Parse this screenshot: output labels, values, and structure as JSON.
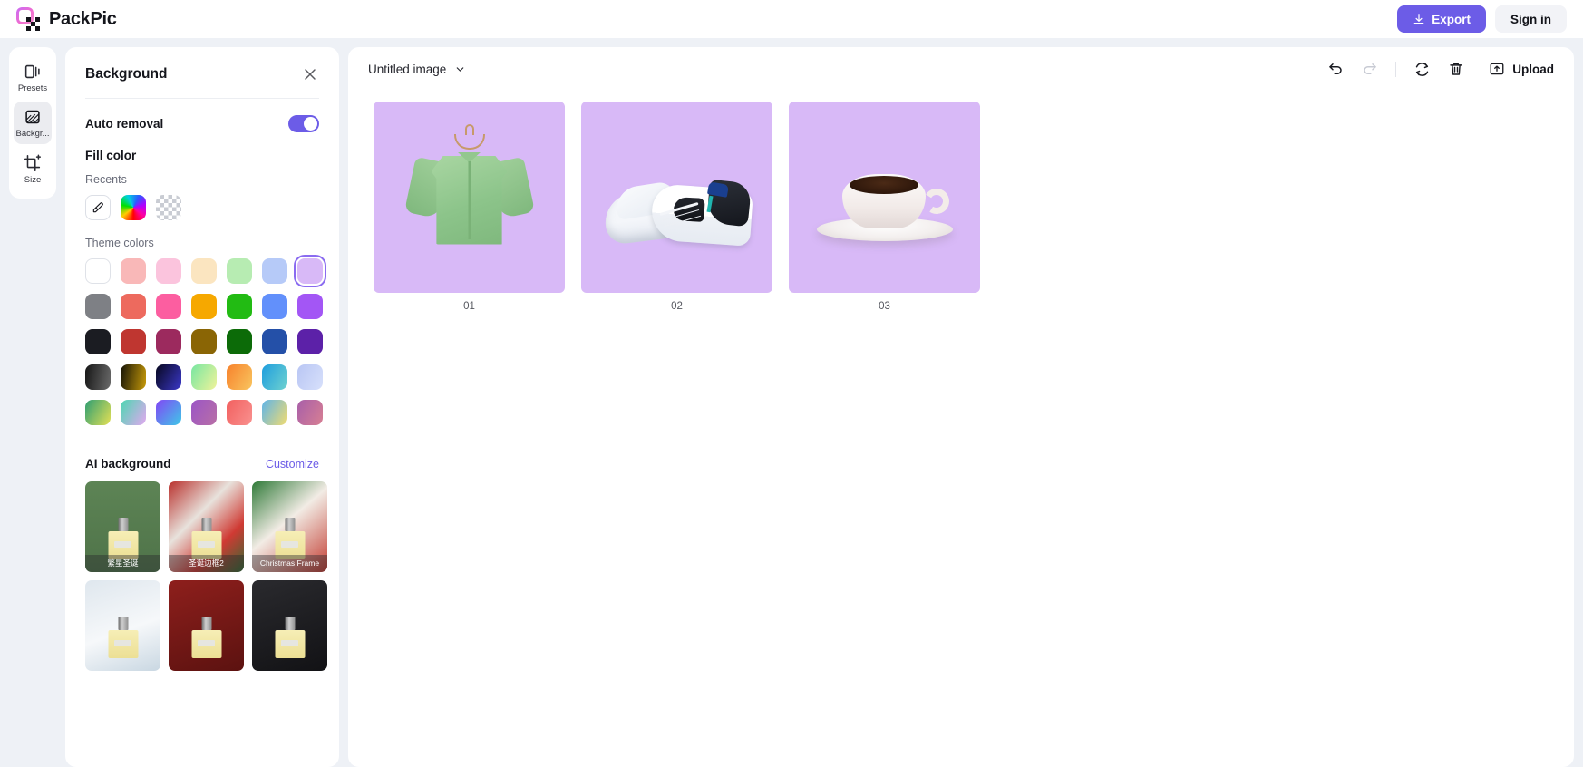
{
  "app": {
    "brand": "PackPic",
    "logo_icon": "packpic-logo-icon"
  },
  "header": {
    "export_label": "Export",
    "export_icon": "download-icon",
    "signin_label": "Sign in",
    "accent_color": "#6c5ce7"
  },
  "rail": {
    "items": [
      {
        "label": "Presets",
        "icon": "presets-icon",
        "active": false
      },
      {
        "label": "Backgr...",
        "icon": "background-icon",
        "active": true
      },
      {
        "label": "Size",
        "icon": "crop-size-icon",
        "active": false
      }
    ]
  },
  "panel": {
    "title": "Background",
    "close_icon": "close-icon",
    "auto_removal": {
      "label": "Auto removal",
      "enabled": true
    },
    "fill_color": {
      "title": "Fill color",
      "recents_label": "Recents",
      "recents": [
        {
          "name": "eyedropper-swatch",
          "kind": "eyedropper"
        },
        {
          "name": "rainbow-swatch",
          "kind": "rainbow"
        },
        {
          "name": "transparent-swatch",
          "kind": "transparent"
        }
      ],
      "theme_colors_label": "Theme colors",
      "theme_colors": [
        {
          "hex": "#ffffff",
          "selected": false
        },
        {
          "hex": "#f9b8b8",
          "selected": false
        },
        {
          "hex": "#fbc4dd",
          "selected": false
        },
        {
          "hex": "#fbe5c0",
          "selected": false
        },
        {
          "hex": "#b7ecb2",
          "selected": false
        },
        {
          "hex": "#b6caf8",
          "selected": false
        },
        {
          "hex": "#d8b9f7",
          "selected": true
        },
        {
          "hex": "#7e8085",
          "selected": false
        },
        {
          "hex": "#ed6a5e",
          "selected": false
        },
        {
          "hex": "#fc5ea0",
          "selected": false
        },
        {
          "hex": "#f6a800",
          "selected": false
        },
        {
          "hex": "#22bb13",
          "selected": false
        },
        {
          "hex": "#6290fb",
          "selected": false
        },
        {
          "hex": "#a356f5",
          "selected": false
        },
        {
          "hex": "#1b1c22",
          "selected": false
        },
        {
          "hex": "#bf3630",
          "selected": false
        },
        {
          "hex": "#9c2a5e",
          "selected": false
        },
        {
          "hex": "#8a6505",
          "selected": false
        },
        {
          "hex": "#0c6b08",
          "selected": false
        },
        {
          "hex": "#2450a8",
          "selected": false
        },
        {
          "hex": "#5c21a8",
          "selected": false
        },
        {
          "hex": "#2b2b2b",
          "gradient": "linear-gradient(100deg,#161616,#6a6a6a)",
          "selected": false
        },
        {
          "hex": "#7a5f06",
          "gradient": "linear-gradient(100deg,#141206,#c79a09)",
          "selected": false
        },
        {
          "hex": "#1b1b63",
          "gradient": "linear-gradient(120deg,#07071e,#3b38c9)",
          "selected": false
        },
        {
          "hex": "#9de8a0",
          "gradient": "linear-gradient(120deg,#78e6a2,#eff39a)",
          "selected": false
        },
        {
          "hex": "#f79a4a",
          "gradient": "linear-gradient(120deg,#f7822c,#f9c55f)",
          "selected": false
        },
        {
          "hex": "#3fb4e0",
          "gradient": "linear-gradient(120deg,#1f9ede,#6fd2d0)",
          "selected": false
        },
        {
          "hex": "#c3cef3",
          "gradient": "linear-gradient(120deg,#b9c6f4,#d7e0fb)",
          "selected": false
        },
        {
          "hex": "#3fae86",
          "gradient": "linear-gradient(120deg,#2f9e72,#e3e055)",
          "selected": false
        },
        {
          "hex": "#7fd9c0",
          "gradient": "linear-gradient(120deg,#4cd6b1,#e2a8f0)",
          "selected": false
        },
        {
          "hex": "#8a4df2",
          "gradient": "linear-gradient(130deg,#8246f5,#3ec9e8)",
          "selected": false
        },
        {
          "hex": "#8f5bc8",
          "gradient": "linear-gradient(120deg,#9b55c6,#b86fa6)",
          "selected": false
        },
        {
          "hex": "#f1717c",
          "gradient": "linear-gradient(120deg,#f2605f,#f9918f)",
          "selected": false
        },
        {
          "hex": "#e9cf6a",
          "gradient": "linear-gradient(120deg,#5fb4e8,#f2dc70)",
          "selected": false
        },
        {
          "hex": "#b06aa8",
          "gradient": "linear-gradient(120deg,#a85fa9,#d77f93)",
          "selected": false
        }
      ]
    },
    "ai_background": {
      "title": "AI background",
      "customize_label": "Customize",
      "items": [
        {
          "caption": "繁星圣诞",
          "style": "green"
        },
        {
          "caption": "圣诞边框2",
          "style": "wreath"
        },
        {
          "caption": "Christmas Frame",
          "style": "frame"
        },
        {
          "caption": "",
          "style": "snow"
        },
        {
          "caption": "",
          "style": "red"
        },
        {
          "caption": "",
          "style": "dark"
        }
      ]
    }
  },
  "canvas": {
    "file_name": "Untitled image",
    "file_name_chevron": "chevron-down-icon",
    "toolbar": {
      "undo_icon": "undo-icon",
      "redo_icon": "redo-icon",
      "reset_icon": "reset-icon",
      "delete_icon": "trash-icon",
      "upload_label": "Upload",
      "upload_icon": "upload-icon"
    },
    "images": [
      {
        "label": "01",
        "subject": "green-shirt",
        "bg": "#d8b9f7"
      },
      {
        "label": "02",
        "subject": "sneaker",
        "bg": "#d8b9f7"
      },
      {
        "label": "03",
        "subject": "coffee-cup",
        "bg": "#d8b9f7"
      }
    ]
  }
}
